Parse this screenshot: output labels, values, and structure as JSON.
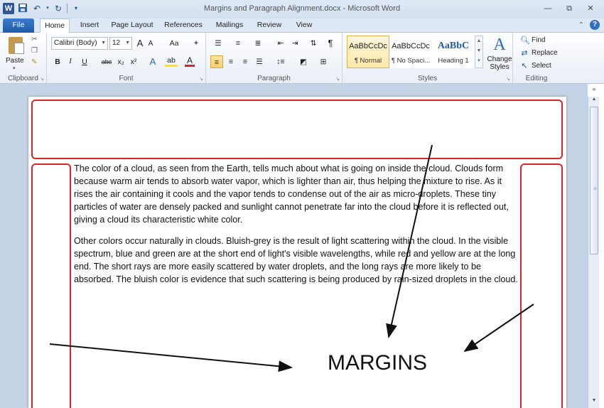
{
  "window": {
    "title": "Margins and Paragraph Alignment.docx - Microsoft Word",
    "controls": [
      "minimize-icon",
      "restore-icon",
      "close-icon"
    ]
  },
  "quick_access": {
    "app_icon_letter": "W",
    "items": [
      "save-icon",
      "undo-icon",
      "redo-icon",
      "customize-icon"
    ]
  },
  "tabs": [
    "File",
    "Home",
    "Insert",
    "Page Layout",
    "References",
    "Mailings",
    "Review",
    "View"
  ],
  "active_tab": "Home",
  "ribbon": {
    "clipboard": {
      "label": "Clipboard",
      "paste_label": "Paste"
    },
    "font": {
      "label": "Font",
      "font_name": "Calibri (Body)",
      "font_size": "12",
      "grow_glyph": "A",
      "shrink_glyph": "A",
      "change_case_glyph": "Aa",
      "bold_glyph": "B",
      "italic_glyph": "I",
      "underline_glyph": "U",
      "strike_glyph": "abc",
      "subscript_glyph": "x₂",
      "superscript_glyph": "x²",
      "text_effects_glyph": "A",
      "highlight_glyph": "ab",
      "font_color_glyph": "A"
    },
    "paragraph": {
      "label": "Paragraph"
    },
    "styles": {
      "label": "Styles",
      "items": [
        {
          "sample": "AaBbCcDc",
          "name": "¶ Normal"
        },
        {
          "sample": "AaBbCcDc",
          "name": "¶ No Spaci..."
        },
        {
          "sample": "AaBbC",
          "name": "Heading 1"
        }
      ],
      "change_styles_line1": "Change",
      "change_styles_line2": "Styles"
    },
    "editing": {
      "label": "Editing",
      "find": "Find",
      "replace": "Replace",
      "select": "Select"
    }
  },
  "document": {
    "paragraphs": [
      "The color of a cloud, as seen from the Earth, tells much about what is going on inside the cloud. Clouds form because warm air tends to absorb water vapor, which is lighter than air, thus helping the mixture to rise. As it rises the air containing it cools and the vapor tends to condense out of the air as micro-droplets. These tiny particles of water are densely packed and sunlight cannot penetrate far into the cloud before it is reflected out, giving a cloud its characteristic white color.",
      "Other colors occur naturally in clouds. Bluish-grey is the result of light scattering within the cloud. In the visible spectrum, blue and green are at the short end of light's visible wavelengths, while red and yellow are at the long end. The short rays are more easily scattered by water droplets, and the long rays are more likely to be absorbed. The bluish color is evidence that such scattering is being produced by rain-sized droplets in the cloud."
    ]
  },
  "annotation": {
    "label": "MARGINS",
    "highlight_color": "#d9242a"
  },
  "colors": {
    "file_tab": "#2b5fa8",
    "doc_background": "#c4d3e5"
  }
}
